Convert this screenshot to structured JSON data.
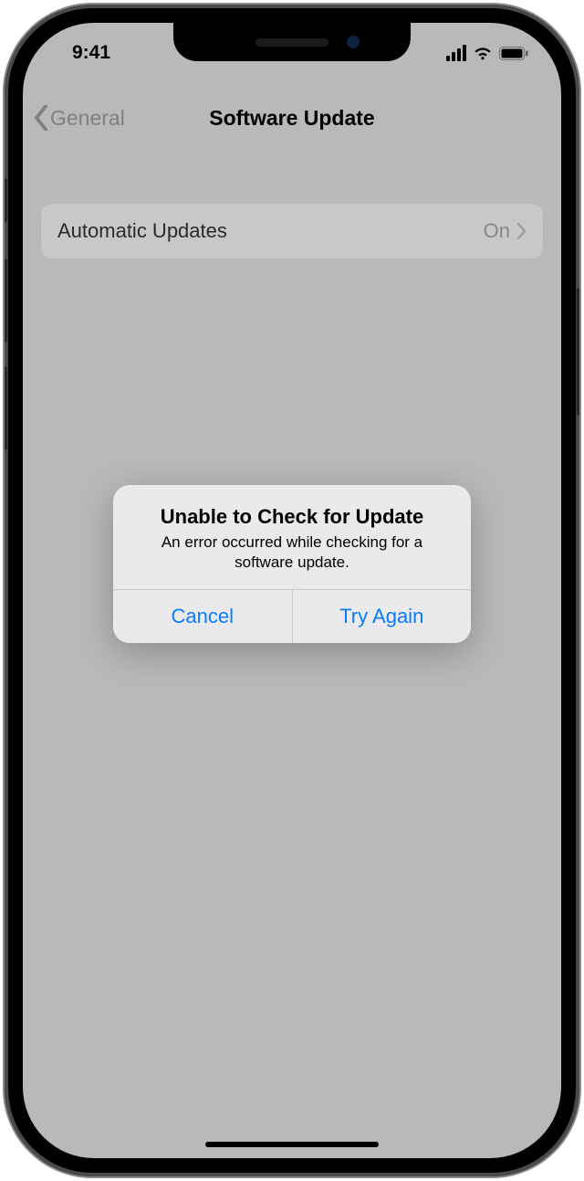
{
  "status": {
    "time": "9:41"
  },
  "nav": {
    "back_label": "General",
    "title": "Software Update"
  },
  "settings": {
    "auto_updates": {
      "label": "Automatic Updates",
      "value": "On"
    }
  },
  "alert": {
    "title": "Unable to Check for Update",
    "message": "An error occurred while checking for a software update.",
    "cancel_label": "Cancel",
    "retry_label": "Try Again"
  }
}
